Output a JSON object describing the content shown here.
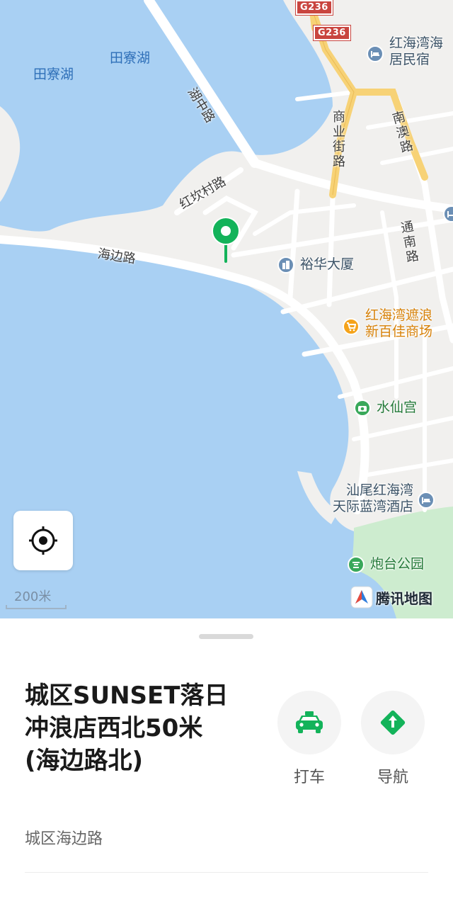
{
  "map": {
    "water_labels": [
      "田寮湖",
      "田寮湖"
    ],
    "road_labels": [
      "湖中路",
      "红坎村路",
      "海边路",
      "商业街路",
      "南澳路",
      "通南路"
    ],
    "highway_shields": [
      "G236",
      "G236"
    ],
    "pois": {
      "hostel": "红海湾海\n居民宿",
      "building": "裕华大厦",
      "mall": "红海湾遮浪\n新百佳商场",
      "temple": "水仙宫",
      "hotel": "汕尾红海湾\n天际蓝湾酒店",
      "park": "炮台公园"
    },
    "scale_label": "200米",
    "brand_label": "腾讯地图",
    "colors": {
      "water": "#a9d0f3",
      "land": "#f1f0ee",
      "park": "#cdeccf",
      "highway": "#f7d276",
      "pin": "#13b35a"
    }
  },
  "sheet": {
    "title": "城区SUNSET落日冲浪店西北50米(海边路北)",
    "subtitle": "城区海边路",
    "actions": {
      "taxi_label": "打车",
      "navigate_label": "导航"
    }
  }
}
